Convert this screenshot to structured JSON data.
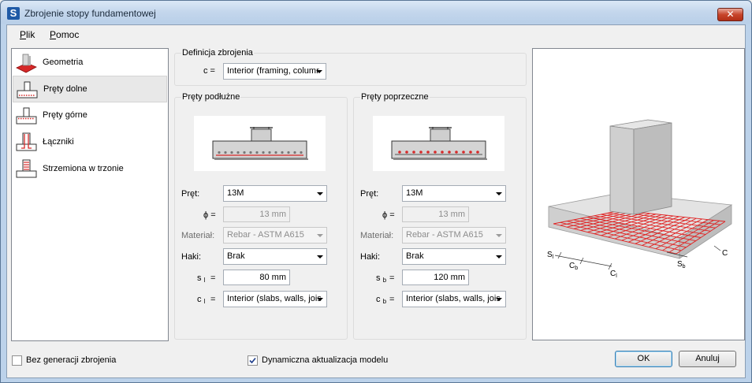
{
  "window": {
    "icon_letter": "S",
    "title": "Zbrojenie stopy fundamentowej",
    "close_glyph": "✕"
  },
  "menu": [
    {
      "label": "Plik",
      "accel": "P",
      "rest": "lik"
    },
    {
      "label": "Pomoc",
      "accel": "P",
      "rest": "omoc"
    }
  ],
  "nav": {
    "selected_index": 1,
    "items": [
      {
        "label": "Geometria",
        "icon": "footing-geometry-icon"
      },
      {
        "label": "Pręty dolne",
        "icon": "bottom-bars-icon"
      },
      {
        "label": "Pręty górne",
        "icon": "top-bars-icon"
      },
      {
        "label": "Łączniki",
        "icon": "dowels-icon"
      },
      {
        "label": "Strzemiona w trzonie",
        "icon": "pier-stirrups-icon"
      }
    ]
  },
  "definition": {
    "title": "Definicja zbrojenia",
    "c_label": "c =",
    "c_value": "Interior (framing, columr"
  },
  "longitudinal": {
    "title": "Pręty podłużne",
    "bar_label": "Pręt:",
    "bar_value": "13M",
    "phi_label": "ϕ =",
    "phi_value": "13 mm",
    "material_label": "Materiał:",
    "material_value": "Rebar - ASTM A615",
    "hooks_label": "Haki:",
    "hooks_value": "Brak",
    "s_label": "s",
    "s_sub": "l",
    "s_eq": "=",
    "s_value": "80 mm",
    "c_label": "c",
    "c_sub": "l",
    "c_eq": "=",
    "c_value": "Interior (slabs, walls, jois"
  },
  "transverse": {
    "title": "Pręty poprzeczne",
    "bar_label": "Pręt:",
    "bar_value": "13M",
    "phi_label": "ϕ =",
    "phi_value": "13 mm",
    "material_label": "Materiał:",
    "material_value": "Rebar - ASTM A615",
    "hooks_label": "Haki:",
    "hooks_value": "Brak",
    "s_label": "s",
    "s_sub": "b",
    "s_eq": "=",
    "s_value": "120 mm",
    "c_label": "c",
    "c_sub": "b",
    "c_eq": "=",
    "c_value": "Interior (slabs, walls, jois"
  },
  "view3d": {
    "labels": {
      "sl": "S",
      "sl_sub": "l",
      "cb": "C",
      "cb_sub": "b",
      "cl": "C",
      "cl_sub": "l",
      "sb": "S",
      "sb_sub": "b",
      "c": "C"
    },
    "rebar_color": "#e02020",
    "concrete_color": "#d9d9d9"
  },
  "footer": {
    "no_generation_label": "Bez generacji zbrojenia",
    "no_generation_checked": false,
    "dynamic_update_label": "Dynamiczna aktualizacja modelu",
    "dynamic_update_checked": true,
    "ok_label": "OK",
    "cancel_label": "Anuluj"
  }
}
